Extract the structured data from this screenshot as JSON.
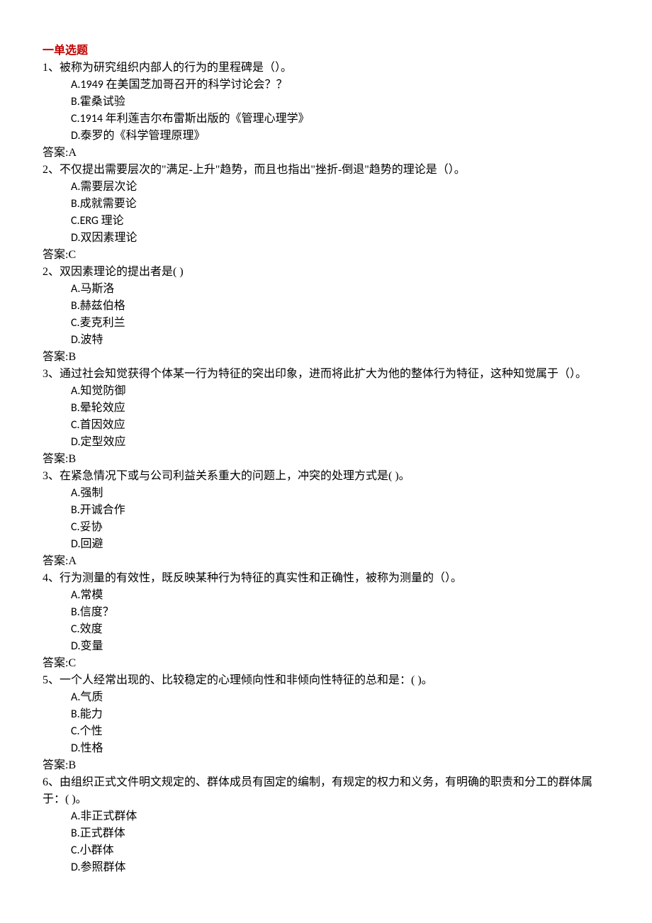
{
  "section_header": "一单选题",
  "questions": [
    {
      "number": "1、",
      "text": "被称为研究组织内部人的行为的里程碑是（）。",
      "options": [
        "A.1949 在美国芝加哥召开的科学讨论会？？",
        "B.霍桑试验",
        "C.1914 年利莲吉尔布雷斯出版的《管理心理学》",
        "D.泰罗的《科学管理原理》"
      ],
      "answer": "答案:A"
    },
    {
      "number": "2、",
      "text": "不仅提出需要层次的\"满足-上升\"趋势，而且也指出\"挫折-倒退\"趋势的理论是（）。",
      "options": [
        "A.需要层次论",
        "B.成就需要论",
        "C.ERG 理论",
        "D.双因素理论"
      ],
      "answer": "答案:C"
    },
    {
      "number": "2、",
      "text": "双因素理论的提出者是(  )",
      "options": [
        "A.马斯洛",
        "B.赫兹伯格",
        "C.麦克利兰",
        "D.波特"
      ],
      "answer": "答案:B"
    },
    {
      "number": "3、",
      "text": "通过社会知觉获得个体某一行为特征的突出印象，进而将此扩大为他的整体行为特征，这种知觉属于（）。",
      "options": [
        "A.知觉防御",
        "B.晕轮效应",
        "C.首因效应",
        "D.定型效应"
      ],
      "answer": "答案:B"
    },
    {
      "number": "3、",
      "text": "在紧急情况下或与公司利益关系重大的问题上，冲突的处理方式是( )。",
      "options": [
        "A.强制",
        "B.开诚合作",
        "C.妥协",
        "D.回避"
      ],
      "answer": "答案:A"
    },
    {
      "number": "4、",
      "text": "行为测量的有效性，既反映某种行为特征的真实性和正确性，被称为测量的（）。",
      "options": [
        "A.常模",
        "B.信度？",
        "C.效度",
        "D.变量"
      ],
      "answer": "答案:C"
    },
    {
      "number": "5、",
      "text": "一个人经常出现的、比较稳定的心理倾向性和非倾向性特征的总和是：(     )。",
      "options": [
        "A.气质",
        "B.能力",
        "C.个性",
        "D.性格"
      ],
      "answer": "答案:B"
    },
    {
      "number": "6、",
      "text": "由组织正式文件明文规定的、群体成员有固定的编制，有规定的权力和义务，有明确的职责和分工的群体属于：(   )。",
      "options": [
        "A.非正式群体",
        "B.正式群体",
        "C.小群体",
        "D.参照群体"
      ],
      "answer": ""
    }
  ]
}
